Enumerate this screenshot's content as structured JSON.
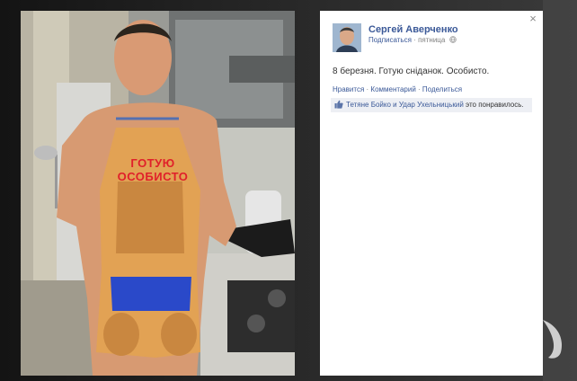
{
  "post": {
    "author": "Сергей Аверченко",
    "subscribe_label": "Подписаться",
    "dot_separator": "·",
    "time_label": "пятница",
    "text": "8 березня. Готую сніданок. Особисто.",
    "actions": {
      "like": "Нравится",
      "comment": "Комментарий",
      "share": "Поделиться",
      "separator": " · "
    },
    "likes": {
      "people": "Тетяне Бойко и Удар Ухельницький",
      "suffix": " это понравилось."
    },
    "close_glyph": "×"
  },
  "photo": {
    "apron_text_line1": "ГОТУЮ",
    "apron_text_line2": "ОСОБИСТО"
  },
  "colors": {
    "link": "#3b5998",
    "apron_text": "#e0202a"
  },
  "icons": [
    "close-icon",
    "globe-icon",
    "thumbs-up-icon",
    "watermark-logo"
  ]
}
